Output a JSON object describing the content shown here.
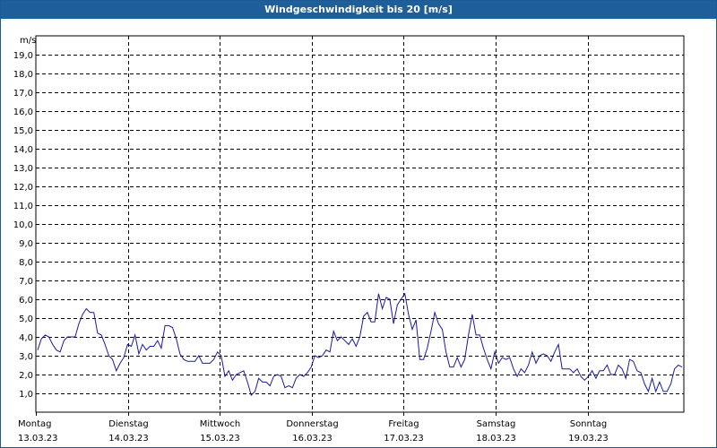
{
  "window": {
    "title": "Windgeschwindigkeit bis 20 [m/s]"
  },
  "colors": {
    "title_bar": "#1e5f99",
    "line": "#1a1aa0",
    "grid": "#000000"
  },
  "chart_data": {
    "type": "line",
    "title": "Windgeschwindigkeit bis 20 [m/s]",
    "ylabel": "m/s",
    "ylim": [
      0,
      20
    ],
    "y_ticks": [
      "1,0",
      "2,0",
      "3,0",
      "4,0",
      "5,0",
      "6,0",
      "7,0",
      "8,0",
      "9,0",
      "10,0",
      "11,0",
      "12,0",
      "13,0",
      "14,0",
      "15,0",
      "16,0",
      "17,0",
      "18,0",
      "19,0"
    ],
    "x_days": [
      {
        "day": "Montag",
        "date": "13.03.23"
      },
      {
        "day": "Dienstag",
        "date": "14.03.23"
      },
      {
        "day": "Mittwoch",
        "date": "15.03.23"
      },
      {
        "day": "Donnerstag",
        "date": "16.03.23"
      },
      {
        "day": "Freitag",
        "date": "17.03.23"
      },
      {
        "day": "Samstag",
        "date": "18.03.23"
      },
      {
        "day": "Sonntag",
        "date": "19.03.23"
      }
    ],
    "grid": true,
    "series": [
      {
        "values": [
          3.3,
          3.9,
          4.1,
          4.0,
          3.6,
          3.3,
          3.2,
          3.8,
          4.0,
          4.0,
          4.0,
          4.7,
          5.2,
          5.5,
          5.3,
          5.3,
          4.2,
          4.1,
          3.6,
          3.0,
          2.8,
          2.2,
          2.6,
          2.9,
          3.6,
          3.5,
          4.1,
          3.1,
          3.6,
          3.3,
          3.5,
          3.5,
          3.8,
          3.4,
          4.6,
          4.6,
          4.5,
          3.9,
          3.1,
          2.8,
          2.7,
          2.7,
          2.7,
          3.0,
          2.6,
          2.6,
          2.6,
          2.8,
          3.2,
          3.0,
          1.9,
          2.2,
          1.7,
          2.0,
          2.1,
          2.2,
          1.6,
          0.9,
          1.1,
          1.8,
          1.6,
          1.6,
          1.4,
          1.9,
          2.0,
          1.9,
          1.3,
          1.4,
          1.3,
          1.8,
          2.0,
          1.9,
          2.1,
          2.4,
          3.0,
          2.9,
          3.0,
          3.3,
          3.2,
          4.3,
          3.8,
          4.0,
          3.8,
          3.6,
          3.9,
          3.5,
          4.0,
          5.1,
          5.3,
          4.8,
          4.8,
          6.3,
          5.5,
          6.1,
          6.0,
          4.7,
          5.7,
          6.0,
          6.3,
          5.2,
          4.4,
          4.9,
          2.8,
          2.8,
          3.4,
          4.3,
          5.3,
          4.7,
          4.4,
          3.2,
          2.4,
          2.4,
          2.9,
          2.4,
          2.8,
          4.1,
          5.2,
          4.1,
          4.1,
          3.4,
          2.8,
          2.3,
          3.2,
          2.6,
          2.9,
          2.8,
          2.9,
          2.3,
          1.9,
          2.3,
          2.1,
          2.5,
          3.2,
          2.6,
          3.0,
          3.1,
          3.0,
          2.7,
          3.2,
          3.6,
          2.3,
          2.3,
          2.3,
          2.1,
          2.3,
          1.9,
          1.7,
          1.9,
          2.2,
          1.8,
          2.2,
          2.2,
          2.5,
          2.0,
          2.0,
          2.5,
          2.3,
          1.8,
          2.8,
          2.7,
          2.2,
          2.1,
          1.5,
          1.1,
          1.8,
          1.1,
          1.6,
          1.1,
          1.1,
          1.5,
          2.3,
          2.5,
          2.4
        ]
      }
    ]
  }
}
